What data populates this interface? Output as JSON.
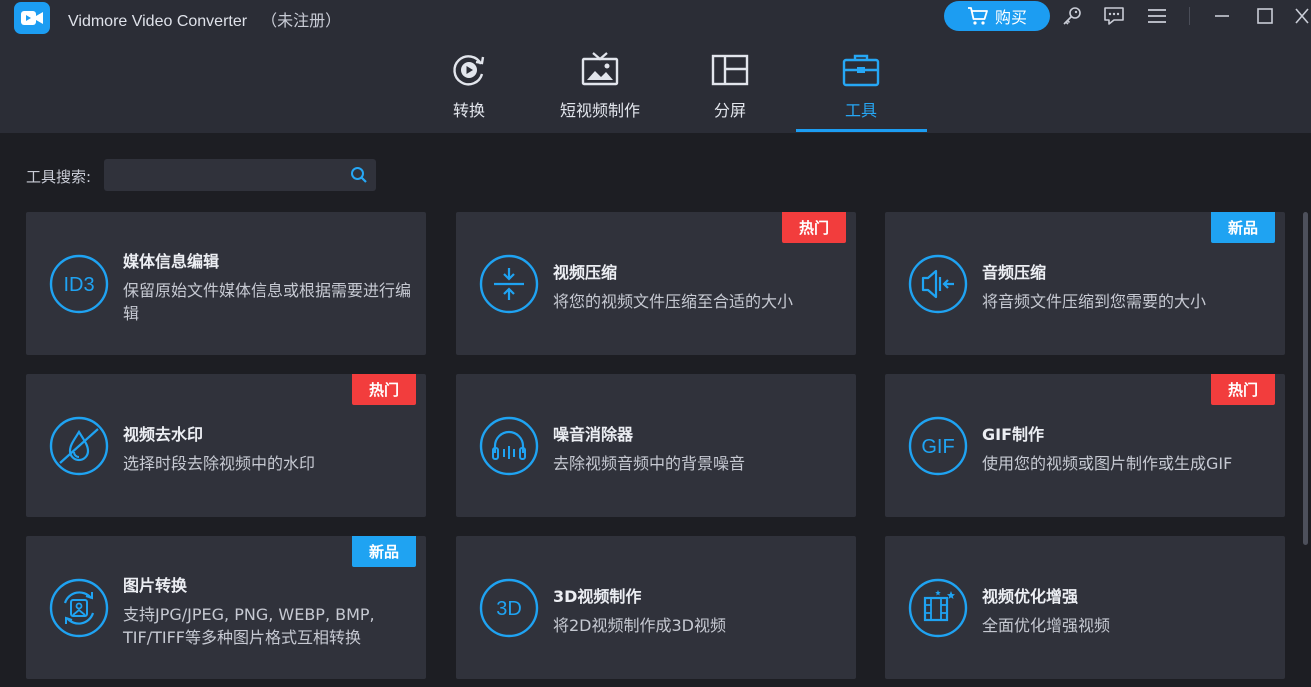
{
  "app": {
    "title": "Vidmore Video Converter",
    "status": "（未注册）",
    "buy_label": "购买"
  },
  "window_controls": [
    "key-icon",
    "feedback-icon",
    "menu-icon",
    "minimize-icon",
    "maximize-icon",
    "close-icon"
  ],
  "tabs": [
    {
      "label": "转换",
      "icon": "convert-icon",
      "active": false
    },
    {
      "label": "短视频制作",
      "icon": "tv-icon",
      "active": false
    },
    {
      "label": "分屏",
      "icon": "split-screen-icon",
      "active": false
    },
    {
      "label": "工具",
      "icon": "toolbox-icon",
      "active": true
    }
  ],
  "search": {
    "label": "工具搜索:",
    "value": "",
    "placeholder": ""
  },
  "tools": [
    {
      "title": "媒体信息编辑",
      "desc": "保留原始文件媒体信息或根据需要进行编辑",
      "icon": "id3-icon",
      "badge": ""
    },
    {
      "title": "视频压缩",
      "desc": "将您的视频文件压缩至合适的大小",
      "icon": "compress-icon",
      "badge": "热门"
    },
    {
      "title": "音频压缩",
      "desc": "将音频文件压缩到您需要的大小",
      "icon": "audio-compress-icon",
      "badge": "新品"
    },
    {
      "title": "视频去水印",
      "desc": "选择时段去除视频中的水印",
      "icon": "watermark-remove-icon",
      "badge": "热门"
    },
    {
      "title": "噪音消除器",
      "desc": "去除视频音频中的背景噪音",
      "icon": "headphones-icon",
      "badge": ""
    },
    {
      "title": "GIF制作",
      "desc": "使用您的视频或图片制作或生成GIF",
      "icon": "gif-icon",
      "badge": "热门"
    },
    {
      "title": "图片转换",
      "desc": "支持JPG/JPEG, PNG, WEBP, BMP, TIF/TIFF等多种图片格式互相转换",
      "icon": "image-convert-icon",
      "badge": "新品"
    },
    {
      "title": "3D视频制作",
      "desc": "将2D视频制作成3D视频",
      "icon": "3d-icon",
      "badge": ""
    },
    {
      "title": "视频优化增强",
      "desc": "全面优化增强视频",
      "icon": "enhance-icon",
      "badge": ""
    }
  ],
  "colors": {
    "accent": "#1c9df2",
    "hot_badge": "#f23d3d",
    "new_badge": "#1fa3f2",
    "header_bg": "#2b2d36",
    "card_bg": "#30323b",
    "page_bg": "#1d1e23"
  }
}
